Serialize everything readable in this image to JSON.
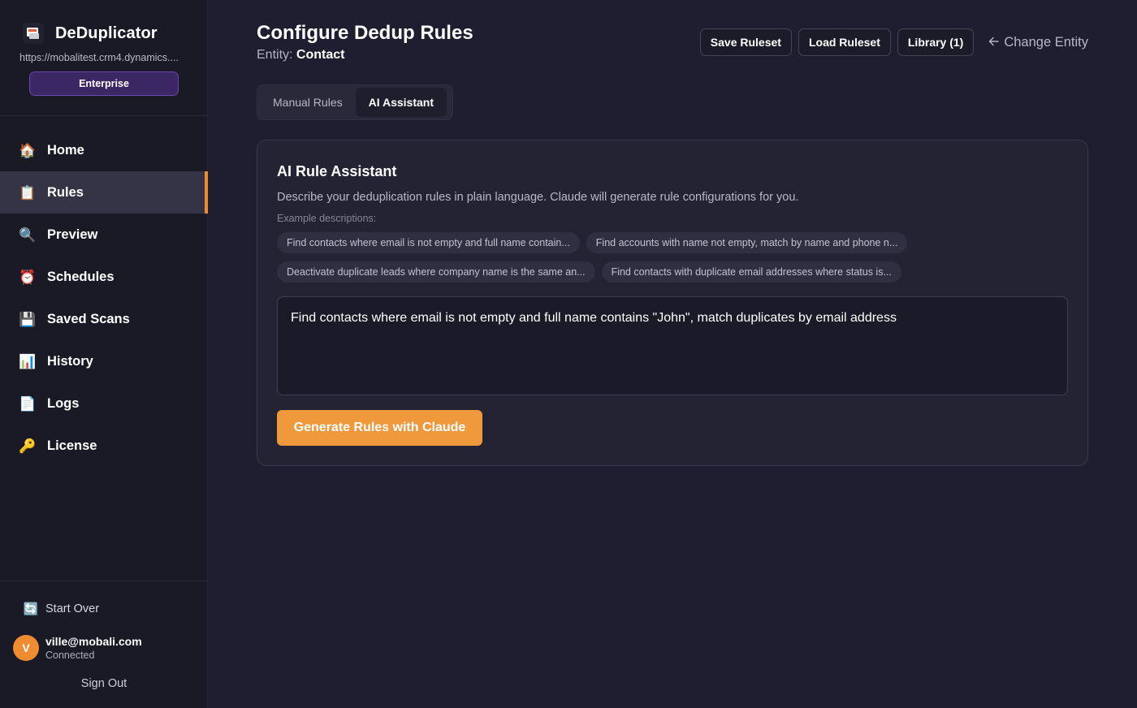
{
  "app": {
    "name": "DeDuplicator",
    "url": "https://mobalitest.crm4.dynamics....",
    "plan": "Enterprise"
  },
  "sidebar": {
    "items": [
      {
        "label": "Home",
        "icon": "house-icon",
        "active": false
      },
      {
        "label": "Rules",
        "icon": "clipboard-icon",
        "active": true
      },
      {
        "label": "Preview",
        "icon": "magnifier-icon",
        "active": false
      },
      {
        "label": "Schedules",
        "icon": "alarm-clock-icon",
        "active": false
      },
      {
        "label": "Saved Scans",
        "icon": "floppy-disk-icon",
        "active": false
      },
      {
        "label": "History",
        "icon": "bar-chart-icon",
        "active": false
      },
      {
        "label": "Logs",
        "icon": "page-icon",
        "active": false
      },
      {
        "label": "License",
        "icon": "key-icon",
        "active": false
      }
    ],
    "start_over": "Start Over",
    "user": {
      "initial": "V",
      "email": "ville@mobali.com",
      "status": "Connected"
    },
    "sign_out": "Sign Out"
  },
  "header": {
    "title": "Configure Dedup Rules",
    "entity_label": "Entity:",
    "entity_value": "Contact",
    "save_ruleset": "Save Ruleset",
    "load_ruleset": "Load Ruleset",
    "library": "Library (1)",
    "change_entity": "Change Entity"
  },
  "tabs": [
    {
      "label": "Manual Rules",
      "active": false
    },
    {
      "label": "AI Assistant",
      "active": true
    }
  ],
  "assistant": {
    "title": "AI Rule Assistant",
    "description": "Describe your deduplication rules in plain language. Claude will generate rule configurations for you.",
    "examples_label": "Example descriptions:",
    "examples": [
      "Find contacts where email is not empty and full name contain...",
      "Find accounts with name not empty, match by name and phone n...",
      "Deactivate duplicate leads where company name is the same an...",
      "Find contacts with duplicate email addresses where status is..."
    ],
    "prompt_value": "Find contacts where email is not empty and full name contains \"John\", match duplicates by email address",
    "generate_label": "Generate Rules with Claude"
  },
  "colors": {
    "accent": "#ef993c",
    "active_indicator": "#ef8b31",
    "plan_badge": "#3b2763",
    "background": "#1f1d30",
    "sidebar": "#1a1a27"
  }
}
